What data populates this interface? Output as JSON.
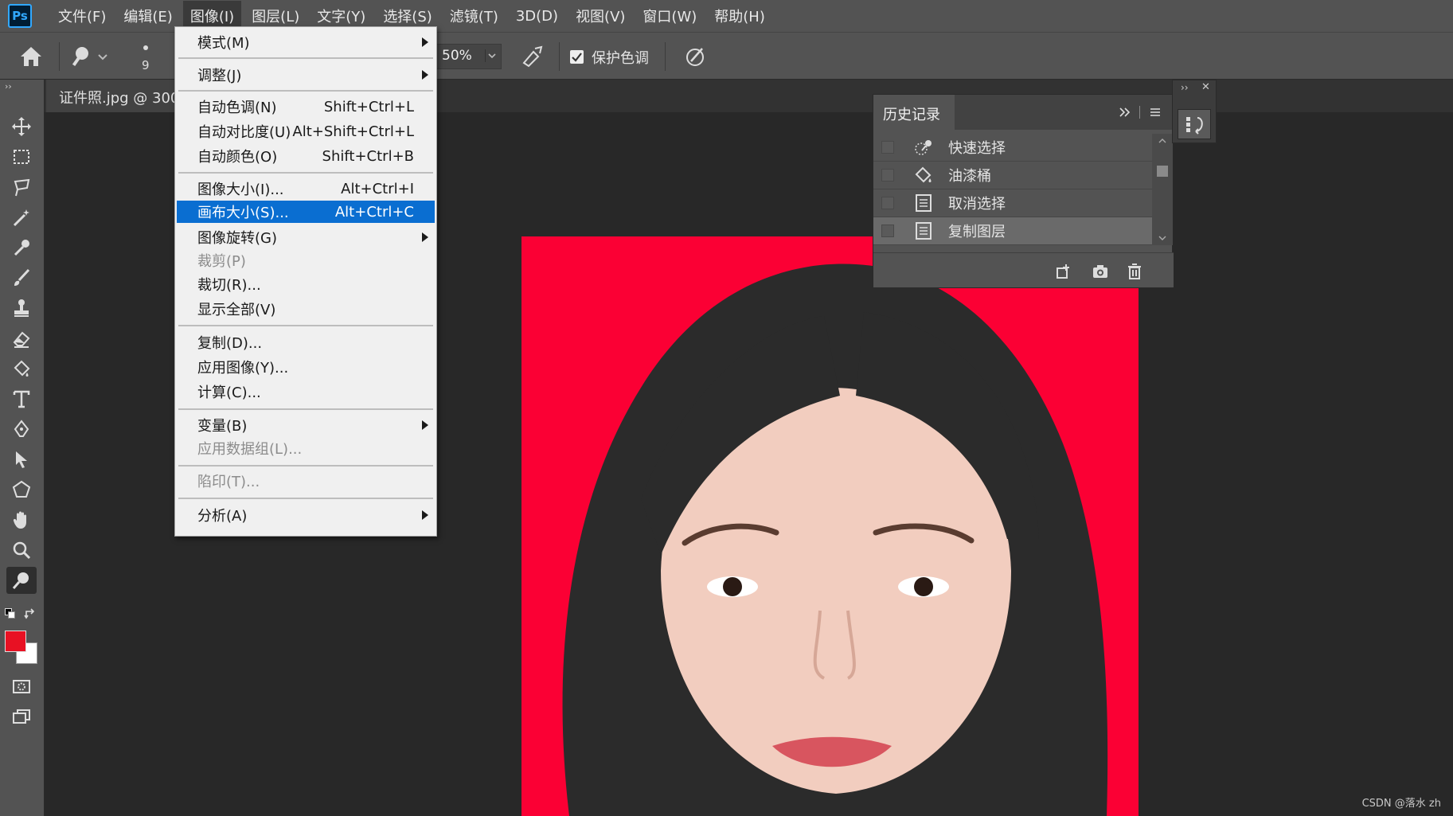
{
  "app": {
    "logo": "Ps"
  },
  "menubar": {
    "items": [
      "文件(F)",
      "编辑(E)",
      "图像(I)",
      "图层(L)",
      "文字(Y)",
      "选择(S)",
      "滤镜(T)",
      "3D(D)",
      "视图(V)",
      "窗口(W)",
      "帮助(H)"
    ],
    "active_index": 2
  },
  "options": {
    "brush_size": "9",
    "strength": "50%",
    "protect_tones_label": "保护色调",
    "protect_tones_checked": true
  },
  "document": {
    "tab_title": "证件照.jpg @ 300"
  },
  "image_menu": {
    "items": [
      {
        "label": "模式(M)",
        "shortcut": "",
        "submenu": true,
        "disabled": false
      },
      {
        "label": "调整(J)",
        "shortcut": "",
        "submenu": true,
        "disabled": false
      },
      {
        "label": "自动色调(N)",
        "shortcut": "Shift+Ctrl+L",
        "submenu": false,
        "disabled": false
      },
      {
        "label": "自动对比度(U)",
        "shortcut": "Alt+Shift+Ctrl+L",
        "submenu": false,
        "disabled": false
      },
      {
        "label": "自动颜色(O)",
        "shortcut": "Shift+Ctrl+B",
        "submenu": false,
        "disabled": false
      },
      {
        "label": "图像大小(I)...",
        "shortcut": "Alt+Ctrl+I",
        "submenu": false,
        "disabled": false
      },
      {
        "label": "画布大小(S)...",
        "shortcut": "Alt+Ctrl+C",
        "submenu": false,
        "disabled": false,
        "highlighted": true
      },
      {
        "label": "图像旋转(G)",
        "shortcut": "",
        "submenu": true,
        "disabled": false
      },
      {
        "label": "裁剪(P)",
        "shortcut": "",
        "submenu": false,
        "disabled": true
      },
      {
        "label": "裁切(R)...",
        "shortcut": "",
        "submenu": false,
        "disabled": false
      },
      {
        "label": "显示全部(V)",
        "shortcut": "",
        "submenu": false,
        "disabled": false
      },
      {
        "label": "复制(D)...",
        "shortcut": "",
        "submenu": false,
        "disabled": false
      },
      {
        "label": "应用图像(Y)...",
        "shortcut": "",
        "submenu": false,
        "disabled": false
      },
      {
        "label": "计算(C)...",
        "shortcut": "",
        "submenu": false,
        "disabled": false
      },
      {
        "label": "变量(B)",
        "shortcut": "",
        "submenu": true,
        "disabled": false
      },
      {
        "label": "应用数据组(L)...",
        "shortcut": "",
        "submenu": false,
        "disabled": true
      },
      {
        "label": "陷印(T)...",
        "shortcut": "",
        "submenu": false,
        "disabled": true
      },
      {
        "label": "分析(A)",
        "shortcut": "",
        "submenu": true,
        "disabled": false
      }
    ]
  },
  "history_panel": {
    "title": "历史记录",
    "items": [
      {
        "label": "快速选择",
        "icon": "quick-selection-icon"
      },
      {
        "label": "油漆桶",
        "icon": "paint-bucket-icon"
      },
      {
        "label": "取消选择",
        "icon": "document-icon"
      },
      {
        "label": "复制图层",
        "icon": "document-icon",
        "selected": true
      }
    ]
  },
  "colors": {
    "foreground": "#e81123",
    "background": "#ffffff",
    "canvas_bg": "#fb0034",
    "highlight": "#0a6ed1"
  },
  "watermark": "CSDN @落水 zh"
}
